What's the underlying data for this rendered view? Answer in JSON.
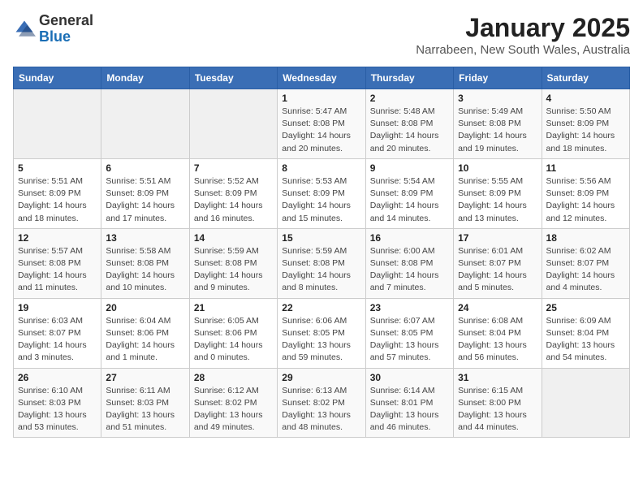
{
  "header": {
    "logo_general": "General",
    "logo_blue": "Blue",
    "title": "January 2025",
    "subtitle": "Narrabeen, New South Wales, Australia"
  },
  "weekdays": [
    "Sunday",
    "Monday",
    "Tuesday",
    "Wednesday",
    "Thursday",
    "Friday",
    "Saturday"
  ],
  "weeks": [
    [
      {
        "day": "",
        "detail": ""
      },
      {
        "day": "",
        "detail": ""
      },
      {
        "day": "",
        "detail": ""
      },
      {
        "day": "1",
        "detail": "Sunrise: 5:47 AM\nSunset: 8:08 PM\nDaylight: 14 hours and 20 minutes."
      },
      {
        "day": "2",
        "detail": "Sunrise: 5:48 AM\nSunset: 8:08 PM\nDaylight: 14 hours and 20 minutes."
      },
      {
        "day": "3",
        "detail": "Sunrise: 5:49 AM\nSunset: 8:08 PM\nDaylight: 14 hours and 19 minutes."
      },
      {
        "day": "4",
        "detail": "Sunrise: 5:50 AM\nSunset: 8:09 PM\nDaylight: 14 hours and 18 minutes."
      }
    ],
    [
      {
        "day": "5",
        "detail": "Sunrise: 5:51 AM\nSunset: 8:09 PM\nDaylight: 14 hours and 18 minutes."
      },
      {
        "day": "6",
        "detail": "Sunrise: 5:51 AM\nSunset: 8:09 PM\nDaylight: 14 hours and 17 minutes."
      },
      {
        "day": "7",
        "detail": "Sunrise: 5:52 AM\nSunset: 8:09 PM\nDaylight: 14 hours and 16 minutes."
      },
      {
        "day": "8",
        "detail": "Sunrise: 5:53 AM\nSunset: 8:09 PM\nDaylight: 14 hours and 15 minutes."
      },
      {
        "day": "9",
        "detail": "Sunrise: 5:54 AM\nSunset: 8:09 PM\nDaylight: 14 hours and 14 minutes."
      },
      {
        "day": "10",
        "detail": "Sunrise: 5:55 AM\nSunset: 8:09 PM\nDaylight: 14 hours and 13 minutes."
      },
      {
        "day": "11",
        "detail": "Sunrise: 5:56 AM\nSunset: 8:09 PM\nDaylight: 14 hours and 12 minutes."
      }
    ],
    [
      {
        "day": "12",
        "detail": "Sunrise: 5:57 AM\nSunset: 8:08 PM\nDaylight: 14 hours and 11 minutes."
      },
      {
        "day": "13",
        "detail": "Sunrise: 5:58 AM\nSunset: 8:08 PM\nDaylight: 14 hours and 10 minutes."
      },
      {
        "day": "14",
        "detail": "Sunrise: 5:59 AM\nSunset: 8:08 PM\nDaylight: 14 hours and 9 minutes."
      },
      {
        "day": "15",
        "detail": "Sunrise: 5:59 AM\nSunset: 8:08 PM\nDaylight: 14 hours and 8 minutes."
      },
      {
        "day": "16",
        "detail": "Sunrise: 6:00 AM\nSunset: 8:08 PM\nDaylight: 14 hours and 7 minutes."
      },
      {
        "day": "17",
        "detail": "Sunrise: 6:01 AM\nSunset: 8:07 PM\nDaylight: 14 hours and 5 minutes."
      },
      {
        "day": "18",
        "detail": "Sunrise: 6:02 AM\nSunset: 8:07 PM\nDaylight: 14 hours and 4 minutes."
      }
    ],
    [
      {
        "day": "19",
        "detail": "Sunrise: 6:03 AM\nSunset: 8:07 PM\nDaylight: 14 hours and 3 minutes."
      },
      {
        "day": "20",
        "detail": "Sunrise: 6:04 AM\nSunset: 8:06 PM\nDaylight: 14 hours and 1 minute."
      },
      {
        "day": "21",
        "detail": "Sunrise: 6:05 AM\nSunset: 8:06 PM\nDaylight: 14 hours and 0 minutes."
      },
      {
        "day": "22",
        "detail": "Sunrise: 6:06 AM\nSunset: 8:05 PM\nDaylight: 13 hours and 59 minutes."
      },
      {
        "day": "23",
        "detail": "Sunrise: 6:07 AM\nSunset: 8:05 PM\nDaylight: 13 hours and 57 minutes."
      },
      {
        "day": "24",
        "detail": "Sunrise: 6:08 AM\nSunset: 8:04 PM\nDaylight: 13 hours and 56 minutes."
      },
      {
        "day": "25",
        "detail": "Sunrise: 6:09 AM\nSunset: 8:04 PM\nDaylight: 13 hours and 54 minutes."
      }
    ],
    [
      {
        "day": "26",
        "detail": "Sunrise: 6:10 AM\nSunset: 8:03 PM\nDaylight: 13 hours and 53 minutes."
      },
      {
        "day": "27",
        "detail": "Sunrise: 6:11 AM\nSunset: 8:03 PM\nDaylight: 13 hours and 51 minutes."
      },
      {
        "day": "28",
        "detail": "Sunrise: 6:12 AM\nSunset: 8:02 PM\nDaylight: 13 hours and 49 minutes."
      },
      {
        "day": "29",
        "detail": "Sunrise: 6:13 AM\nSunset: 8:02 PM\nDaylight: 13 hours and 48 minutes."
      },
      {
        "day": "30",
        "detail": "Sunrise: 6:14 AM\nSunset: 8:01 PM\nDaylight: 13 hours and 46 minutes."
      },
      {
        "day": "31",
        "detail": "Sunrise: 6:15 AM\nSunset: 8:00 PM\nDaylight: 13 hours and 44 minutes."
      },
      {
        "day": "",
        "detail": ""
      }
    ]
  ]
}
